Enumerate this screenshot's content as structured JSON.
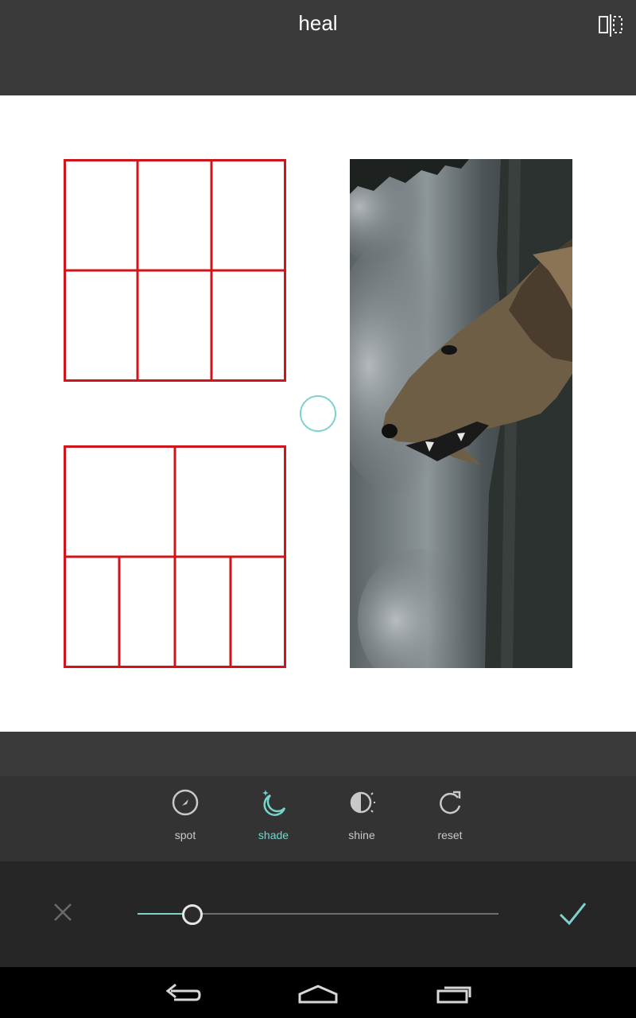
{
  "header": {
    "title": "heal"
  },
  "tools": [
    {
      "label": "spot",
      "icon": "spot-icon",
      "active": false
    },
    {
      "label": "shade",
      "icon": "shade-icon",
      "active": true
    },
    {
      "label": "shine",
      "icon": "shine-icon",
      "active": false
    },
    {
      "label": "reset",
      "icon": "reset-icon",
      "active": false
    }
  ],
  "slider": {
    "value": 0.15
  },
  "colors": {
    "accent": "#7fd3cc",
    "grid": "#d0141c",
    "topbar": "#3a3a3a",
    "panel": "#333333",
    "sliderPanel": "#262626"
  }
}
